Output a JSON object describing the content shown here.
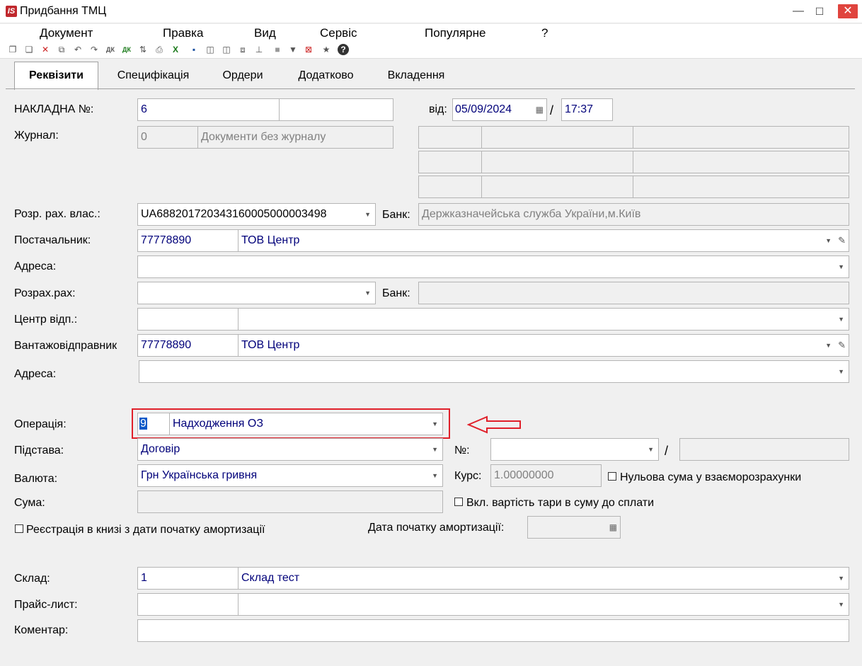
{
  "window": {
    "title": "Придбання ТМЦ",
    "logo": "IS",
    "buttons": {
      "minimize": "—",
      "maximize": "☐",
      "close": "✕"
    }
  },
  "menu": [
    "Документ",
    "Правка",
    "Вид",
    "Сервіс",
    "Популярне",
    "?"
  ],
  "toolbar_icons": [
    "copy-icon",
    "paste-icon",
    "delete-icon",
    "duplicate-icon",
    "undo-icon",
    "redo-icon",
    "dk-icon",
    "dk2-icon",
    "compare-icon",
    "print-icon",
    "excel-icon",
    "save-icon",
    "book-icon",
    "book2-icon",
    "link-icon",
    "tree-icon",
    "gray-icon",
    "filter-icon",
    "clear-filter-icon",
    "star-icon",
    "help-icon"
  ],
  "tabs": [
    "Реквізити",
    "Специфікація",
    "Ордери",
    "Додатково",
    "Вкладення"
  ],
  "form": {
    "nakladna_label": "НАКЛАДНА №:",
    "nakladna_value": "6",
    "nakladna_extra": "",
    "date_label": "від:",
    "date_value": "05/09/2024",
    "slash": "/",
    "time_value": "17:37",
    "journal_label": "Журнал:",
    "journal_code": "0",
    "journal_name": "Документи без журналу",
    "account_label": "Розр. рах. влас.:",
    "account_value": "UA688201720343160005000003498",
    "bank_label": "Банк:",
    "bank_value": "Держказначейська служба України,м.Київ",
    "supplier_label": "Постачальник:",
    "supplier_code": "77778890",
    "supplier_name": "ТОВ Центр",
    "address_label": "Адреса:",
    "address_value": "",
    "calc_label": "Розрах.рах:",
    "calc_value": "",
    "bank2_label": "Банк:",
    "bank2_value": "",
    "center_label": "Центр відп.:",
    "center_code": "",
    "center_name": "",
    "shipper_label": "Вантажовідправник",
    "shipper_code": "77778890",
    "shipper_name": "ТОВ Центр",
    "address2_label": "Адреса:",
    "address2_value": "",
    "operation_label": "Операція:",
    "operation_code": "9",
    "operation_name": "Надходження ОЗ",
    "basis_label": "Підстава:",
    "basis_value": "Договір",
    "number_label": "№:",
    "number_value": "",
    "number_slash": "/",
    "number_extra": "",
    "currency_label": "Валюта:",
    "currency_value": "Грн Українська гривня",
    "rate_label": "Курс:",
    "rate_value": "1.00000000",
    "zero_sum_label": "Нульова сума у взаєморозрахунки",
    "sum_label": "Сума:",
    "sum_value": "",
    "tara_label": "Вкл. вартість тари в суму до сплати",
    "register_label": "Реєстрація в книзі з дати початку амортизації",
    "amort_date_label": "Дата початку амортизації:",
    "amort_date_value": "",
    "warehouse_label": "Склад:",
    "warehouse_code": "1",
    "warehouse_name": "Склад тест",
    "pricelist_label": "Прайс-лист:",
    "pricelist_code": "",
    "pricelist_name": "",
    "comment_label": "Коментар:",
    "comment_value": ""
  }
}
